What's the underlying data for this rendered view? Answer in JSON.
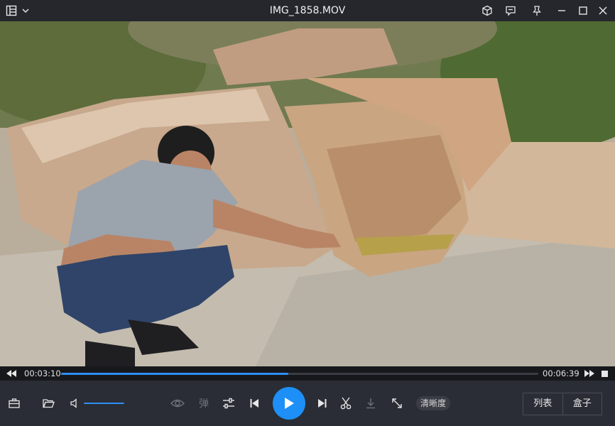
{
  "window": {
    "title": "IMG_1858.MOV"
  },
  "playback": {
    "current_time": "00:03:10",
    "total_time": "00:06:39",
    "progress": 0.476,
    "volume": 0.95
  },
  "controls": {
    "danmu_label": "弹",
    "clarity_label": "清晰度",
    "list_label": "列表",
    "box_label": "盒子"
  },
  "icons": {
    "menu": "list-layout-icon",
    "dropdown": "chevron-down-icon",
    "box3d": "cube-icon",
    "feedback": "comment-icon",
    "pin": "pin-icon",
    "minimize": "minimize-icon",
    "maximize": "maximize-icon",
    "close": "close-icon"
  },
  "colors": {
    "accent": "#1e8ff6",
    "titlebar": "#25272d",
    "controls": "#2a2d35"
  }
}
